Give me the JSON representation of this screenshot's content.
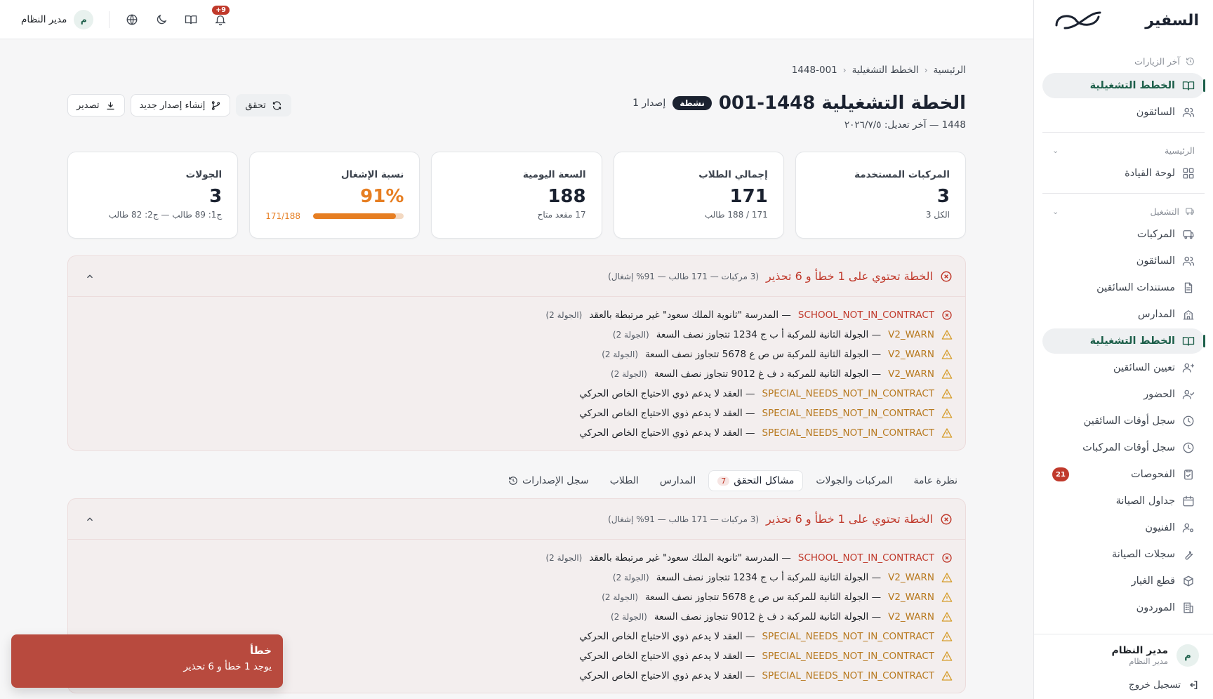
{
  "sidebar": {
    "brand": "السفير",
    "recent_label": "آخر الزيارات",
    "recent_items": [
      {
        "label": "الخطط التشغيلية",
        "icon": "book-open-icon",
        "active": true
      },
      {
        "label": "السائقون",
        "icon": "users-icon",
        "active": false
      }
    ],
    "section_home": "الرئيسية",
    "home_items": [
      {
        "label": "لوحة القيادة",
        "icon": "dashboard-icon"
      }
    ],
    "section_ops": "التشغيل",
    "ops_items": [
      {
        "label": "المركبات",
        "icon": "bus-icon",
        "active": false
      },
      {
        "label": "السائقون",
        "icon": "users-icon",
        "active": false
      },
      {
        "label": "مستندات السائقين",
        "icon": "document-icon",
        "active": false
      },
      {
        "label": "المدارس",
        "icon": "school-icon",
        "active": false
      },
      {
        "label": "الخطط التشغيلية",
        "icon": "book-open-icon",
        "active": true
      },
      {
        "label": "تعيين السائقين",
        "icon": "user-assign-icon",
        "active": false
      },
      {
        "label": "الحضور",
        "icon": "user-check-icon",
        "active": false
      },
      {
        "label": "سجل أوقات السائقين",
        "icon": "clock-icon",
        "active": false
      },
      {
        "label": "سجل أوقات المركبات",
        "icon": "clock-icon",
        "active": false
      },
      {
        "label": "الفحوصات",
        "icon": "clipboard-check-icon",
        "active": false,
        "badge": "21"
      },
      {
        "label": "جداول الصيانة",
        "icon": "calendar-icon",
        "active": false
      },
      {
        "label": "الفنيون",
        "icon": "user-gear-icon",
        "active": false
      },
      {
        "label": "سجلات الصيانة",
        "icon": "wrench-icon",
        "active": false
      },
      {
        "label": "قطع الغيار",
        "icon": "box-icon",
        "active": false
      },
      {
        "label": "الموردون",
        "icon": "building-icon",
        "active": false
      }
    ],
    "user": {
      "initial": "م",
      "name": "مدير النظام",
      "role": "مدير النظام"
    },
    "logout_label": "تسجيل خروج"
  },
  "topbar": {
    "notifications_badge": "+9",
    "user_initial": "م",
    "user_name": "مدير النظام"
  },
  "breadcrumb": [
    "الرئيسية",
    "الخطط التشغيلية",
    "1448-001"
  ],
  "header": {
    "title": "الخطة التشغيلية 1448-001",
    "status": "نشطة",
    "version": "إصدار 1",
    "subtitle": "1448 — آخر تعديل: ٢٠٢٦/٧/٥",
    "actions": {
      "verify": "تحقق",
      "new_version": "إنشاء إصدار جديد",
      "export": "تصدير"
    }
  },
  "cards": [
    {
      "label": "المركبات المستخدمة",
      "value": "3",
      "sub": "الكل 3"
    },
    {
      "label": "إجمالي الطلاب",
      "value": "171",
      "sub": "171 / 188 طالب"
    },
    {
      "label": "السعة اليومية",
      "value": "188",
      "sub": "17 مقعد متاح"
    },
    {
      "label": "نسبة الإشغال",
      "value": "91%",
      "progress_text": "171/188",
      "progress": 0.91
    },
    {
      "label": "الجولات",
      "value": "3",
      "sub": "ج1: 89 طالب — ج2: 82 طالب"
    }
  ],
  "validation": {
    "title": "الخطة تحتوي على 1 خطأ و 6 تحذير",
    "meta": "(3 مركبات — 171 طالب — 91% إشغال)",
    "issues": [
      {
        "level": "error",
        "code": "SCHOOL_NOT_IN_CONTRACT",
        "text": "— المدرسة \"ثانوية الملك سعود\" غير مرتبطة بالعقد",
        "ctx": "(الجولة 2)"
      },
      {
        "level": "warn",
        "code": "V2_WARN",
        "text": "— الجولة الثانية للمركبة أ ب ج 1234 تتجاوز نصف السعة",
        "ctx": "(الجولة 2)"
      },
      {
        "level": "warn",
        "code": "V2_WARN",
        "text": "— الجولة الثانية للمركبة س ص ع 5678 تتجاوز نصف السعة",
        "ctx": "(الجولة 2)"
      },
      {
        "level": "warn",
        "code": "V2_WARN",
        "text": "— الجولة الثانية للمركبة د ف غ 9012 تتجاوز نصف السعة",
        "ctx": "(الجولة 2)"
      },
      {
        "level": "warn",
        "code": "SPECIAL_NEEDS_NOT_IN_CONTRACT",
        "text": "— العقد لا يدعم ذوي الاحتياج الخاص الحركي",
        "ctx": ""
      },
      {
        "level": "warn",
        "code": "SPECIAL_NEEDS_NOT_IN_CONTRACT",
        "text": "— العقد لا يدعم ذوي الاحتياج الخاص الحركي",
        "ctx": ""
      },
      {
        "level": "warn",
        "code": "SPECIAL_NEEDS_NOT_IN_CONTRACT",
        "text": "— العقد لا يدعم ذوي الاحتياج الخاص الحركي",
        "ctx": ""
      }
    ]
  },
  "tabs": [
    {
      "label": "نظرة عامة",
      "active": false
    },
    {
      "label": "المركبات والجولات",
      "active": false
    },
    {
      "label": "مشاكل التحقق",
      "active": true,
      "count": "7"
    },
    {
      "label": "المدارس",
      "active": false
    },
    {
      "label": "الطلاب",
      "active": false
    },
    {
      "label": "سجل الإصدارات",
      "active": false,
      "icon": "history-icon"
    }
  ],
  "toast": {
    "title": "خطأ",
    "message": "يوجد 1 خطأ و 6 تحذير"
  }
}
